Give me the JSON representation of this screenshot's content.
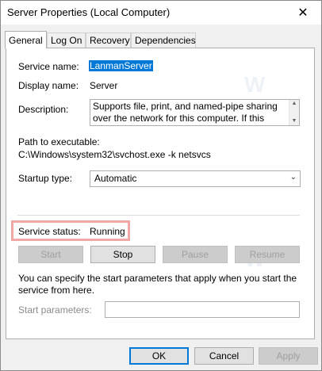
{
  "window": {
    "title": "Server Properties (Local Computer)"
  },
  "tabs": [
    {
      "label": "General",
      "active": true
    },
    {
      "label": "Log On"
    },
    {
      "label": "Recovery"
    },
    {
      "label": "Dependencies"
    }
  ],
  "general": {
    "service_name_label": "Service name:",
    "service_name": "LanmanServer",
    "display_name_label": "Display name:",
    "display_name": "Server",
    "description_label": "Description:",
    "description": "Supports file, print, and named-pipe sharing over the network for this computer. If this service is stopped,",
    "path_label": "Path to executable:",
    "path": "C:\\Windows\\system32\\svchost.exe -k netsvcs",
    "startup_type_label": "Startup type:",
    "startup_type": "Automatic",
    "service_status_label": "Service status:",
    "service_status": "Running",
    "buttons": {
      "start": "Start",
      "stop": "Stop",
      "pause": "Pause",
      "resume": "Resume"
    },
    "help_text": "You can specify the start parameters that apply when you start the service from here.",
    "start_params_label": "Start parameters:",
    "start_params_value": ""
  },
  "footer": {
    "ok": "OK",
    "cancel": "Cancel",
    "apply": "Apply"
  },
  "colors": {
    "highlight": "#f2a7a7",
    "selection": "#0078d7"
  }
}
